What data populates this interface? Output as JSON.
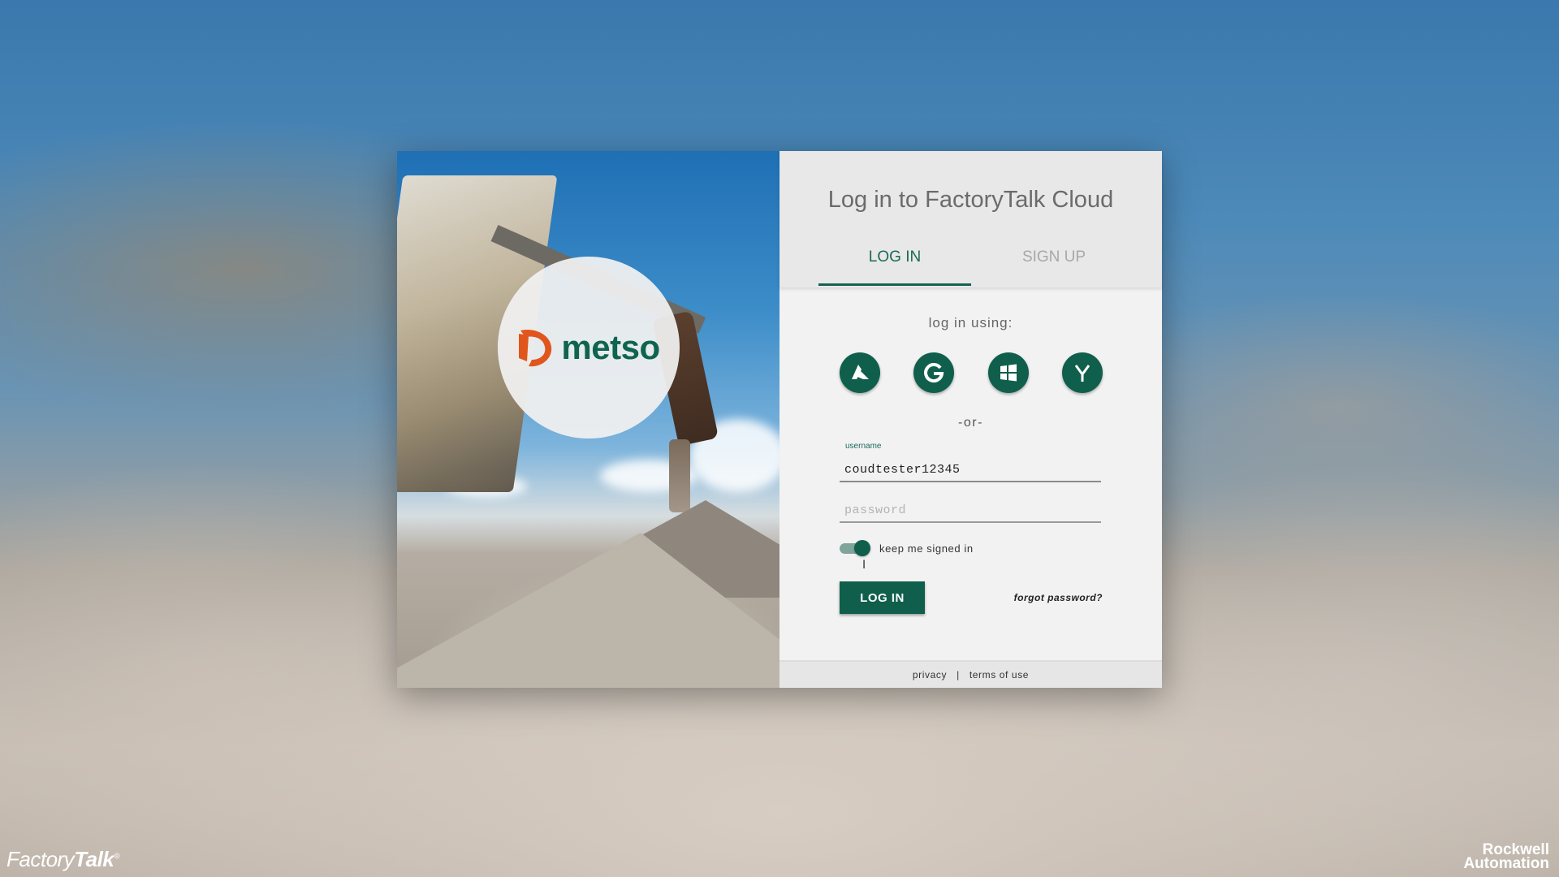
{
  "brand": {
    "left_part1": "Factory",
    "left_part2": "Talk",
    "left_reg": "®",
    "right_line1": "Rockwell",
    "right_line2": "Automation"
  },
  "hero": {
    "logo_text": "metso",
    "logo_icon": "metso-logo-icon"
  },
  "panel": {
    "title": "Log in to FactoryTalk Cloud",
    "tabs": [
      {
        "label": "LOG IN",
        "active": true
      },
      {
        "label": "SIGN UP",
        "active": false
      }
    ],
    "login_using": "log in using:",
    "social_icons": [
      "azure-icon",
      "google-icon",
      "windows-icon",
      "yammer-icon"
    ],
    "or": "-or-",
    "username": {
      "label": "username",
      "value": "coudtester12345"
    },
    "password": {
      "placeholder": "password",
      "value": ""
    },
    "keep_signed_in": {
      "label": "keep me signed in",
      "on": true
    },
    "login_button": "LOG IN",
    "forgot": "forgot password?",
    "footer": {
      "privacy": "privacy",
      "separator": "|",
      "terms": "terms of use"
    }
  },
  "colors": {
    "accent": "#0f5f4c",
    "accent_text": "#1a6b56",
    "panel_bg": "#f2f2f2",
    "header_bg": "#e8e8e8"
  }
}
